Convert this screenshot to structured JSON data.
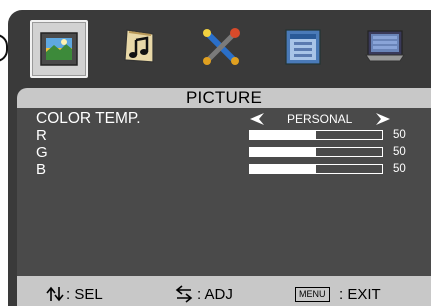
{
  "osd": {
    "tabs": [
      {
        "icon": "picture-icon",
        "active": true
      },
      {
        "icon": "music-note-icon",
        "active": false
      },
      {
        "icon": "tools-icon",
        "active": false
      },
      {
        "icon": "options-window-icon",
        "active": false
      },
      {
        "icon": "monitor-icon",
        "active": false
      }
    ],
    "title": "PICTURE",
    "color_temp": {
      "label": "COLOR TEMP.",
      "value": "PERSONAL"
    },
    "channels": [
      {
        "label": "R",
        "value": "50",
        "level": 50
      },
      {
        "label": "G",
        "value": "50",
        "level": 50
      },
      {
        "label": "B",
        "value": "50",
        "level": 50
      }
    ],
    "footer": {
      "sel": ": SEL",
      "adj": ": ADJ",
      "menu_key": "MENU",
      "exit": ": EXIT"
    },
    "colors": {
      "frame": "#3a3a3a",
      "panel": "#4a4a4a",
      "header": "#c8c8c8"
    }
  }
}
